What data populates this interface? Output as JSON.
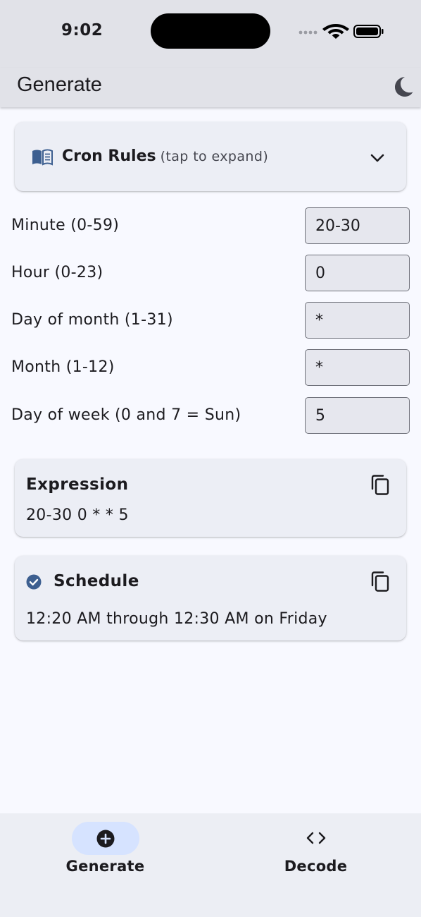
{
  "status_bar": {
    "time": "9:02"
  },
  "app_bar": {
    "title": "Generate"
  },
  "rules": {
    "title": "Cron Rules",
    "hint": "(tap to expand)"
  },
  "fields": [
    {
      "label": "Minute (0-59)",
      "value": "20-30"
    },
    {
      "label": "Hour (0-23)",
      "value": "0"
    },
    {
      "label": "Day of month (1-31)",
      "value": "*"
    },
    {
      "label": "Month (1-12)",
      "value": "*"
    },
    {
      "label": "Day of week (0 and 7 = Sun)",
      "value": "5"
    }
  ],
  "expression": {
    "title": "Expression",
    "value": "20-30 0 * * 5"
  },
  "schedule": {
    "title": "Schedule",
    "value": "12:20 AM through 12:30 AM on Friday"
  },
  "nav": {
    "generate": {
      "label": "Generate",
      "active": true
    },
    "decode": {
      "label": "Decode",
      "active": false
    }
  },
  "icons": {
    "rules": "book-icon",
    "theme": "moon-icon",
    "expand": "chevron-down-icon",
    "copy": "copy-icon",
    "schedule_status": "check-circle-icon",
    "generate": "add-circle-icon",
    "decode": "code-icon"
  },
  "colors": {
    "primary": "#3d5f90",
    "app_bar": "#e1e2e8",
    "surface": "#f8f9ff",
    "card": "#eceef5",
    "nav_indicator": "#d6e3ff"
  }
}
